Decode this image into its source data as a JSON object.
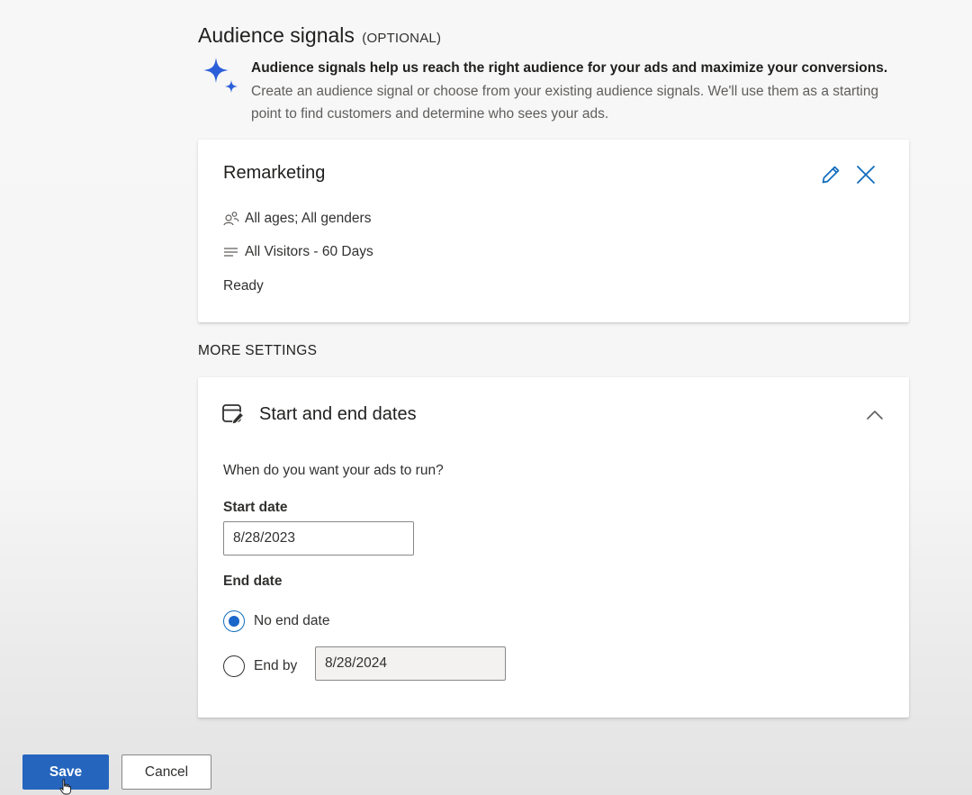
{
  "audience": {
    "title": "Audience signals",
    "optional_label": "(OPTIONAL)",
    "intro_lead": "Audience signals help us reach the right audience for your ads and maximize your conversions.",
    "intro_desc": "Create an audience signal or choose from your existing audience signals. We'll use them as a starting point to find customers and determine who sees your ads.",
    "icon": "sparkle-icon",
    "accent_color": "#2b5fd9"
  },
  "signal_card": {
    "name": "Remarketing",
    "demographics": "All ages; All genders",
    "audience_list": "All Visitors - 60 Days",
    "status": "Ready",
    "icons": [
      "people-icon",
      "list-icon",
      "edit-icon",
      "close-icon"
    ]
  },
  "more_settings": {
    "label": "MORE SETTINGS"
  },
  "dates": {
    "title": "Start and end dates",
    "question": "When do you want your ads to run?",
    "start_label": "Start date",
    "start_value": "8/28/2023",
    "end_label": "End date",
    "no_end_label": "No end date",
    "end_by_label": "End by",
    "end_by_value": "8/28/2024",
    "selected_option": "no_end_date",
    "icons": [
      "calendar-edit-icon",
      "chevron-up-icon"
    ]
  },
  "footer": {
    "save_label": "Save",
    "cancel_label": "Cancel",
    "primary_color": "#2565be"
  }
}
